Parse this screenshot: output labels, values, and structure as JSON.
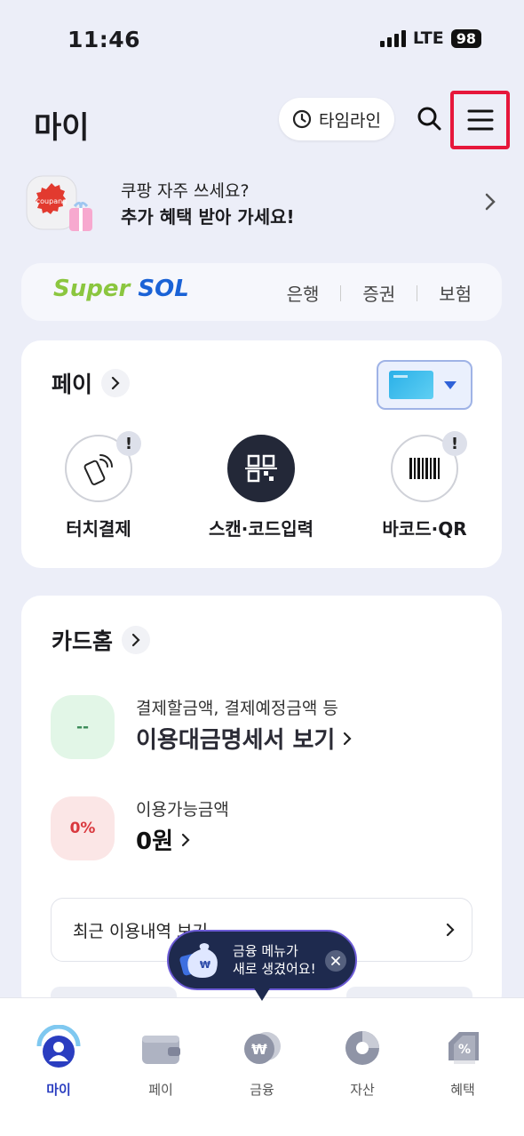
{
  "status_bar": {
    "time": "11:46",
    "network": "LTE",
    "battery": "98"
  },
  "header": {
    "title": "마이",
    "timeline_label": "타임라인"
  },
  "promo": {
    "line1": "쿠팡 자주 쓰세요?",
    "line2": "추가 혜택 받아 가세요!",
    "logo_text": "coupang"
  },
  "supersol": {
    "logo_part1": "Super ",
    "logo_part2": "SOL",
    "links": [
      "은행",
      "증권",
      "보험"
    ]
  },
  "pay": {
    "title": "페이",
    "items": [
      {
        "label": "터치결제",
        "icon": "touch-pay-icon",
        "alert": "!"
      },
      {
        "label": "스캔·코드입력",
        "icon": "qr-scan-icon",
        "alert": ""
      },
      {
        "label": "바코드·QR",
        "icon": "barcode-icon",
        "alert": "!"
      }
    ]
  },
  "cardhome": {
    "title": "카드홈",
    "bill": {
      "badge": "--",
      "sub": "결제할금액, 결제예정금액 등",
      "main": "이용대금명세서 보기"
    },
    "available": {
      "badge": "0%",
      "sub": "이용가능금액",
      "main": "0원"
    },
    "recent_label": "최근 이용내역 보기"
  },
  "toast": {
    "line1": "금융 메뉴가",
    "line2": "새로 생겼어요!"
  },
  "tabbar": {
    "tabs": [
      {
        "label": "마이",
        "active": true
      },
      {
        "label": "페이",
        "active": false
      },
      {
        "label": "금융",
        "active": false
      },
      {
        "label": "자산",
        "active": false
      },
      {
        "label": "혜택",
        "active": false
      }
    ]
  }
}
